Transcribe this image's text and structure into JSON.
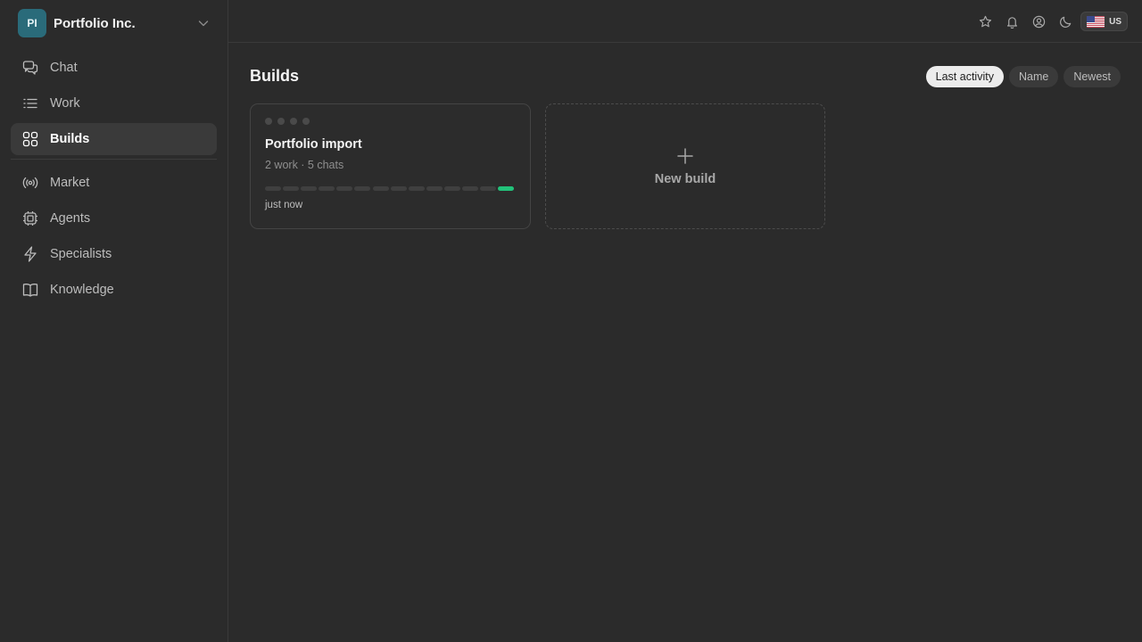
{
  "org": {
    "initials": "PI",
    "name": "Portfolio Inc."
  },
  "sidebar": {
    "items": [
      {
        "label": "Chat",
        "icon": "chat-icon"
      },
      {
        "label": "Work",
        "icon": "list-icon"
      },
      {
        "label": "Builds",
        "icon": "grid-icon",
        "active": true
      },
      {
        "label": "Market",
        "icon": "broadcast-icon"
      },
      {
        "label": "Agents",
        "icon": "cpu-icon"
      },
      {
        "label": "Specialists",
        "icon": "bolt-icon"
      },
      {
        "label": "Knowledge",
        "icon": "book-icon"
      }
    ]
  },
  "topbar": {
    "icons": [
      "star-icon",
      "bell-icon",
      "user-circle-icon",
      "moon-icon"
    ],
    "region": {
      "flag": "us-flag-icon",
      "label": "US"
    }
  },
  "main": {
    "title": "Builds",
    "sort": {
      "options": [
        "Last activity",
        "Name",
        "Newest"
      ],
      "selected": "Last activity"
    },
    "builds": [
      {
        "title": "Portfolio import",
        "meta": "2 work · 5 chats",
        "updated": "just now",
        "activity_segments": 14,
        "active_segment": 14,
        "accent": "#22c27a"
      }
    ],
    "new_build_label": "New build"
  }
}
